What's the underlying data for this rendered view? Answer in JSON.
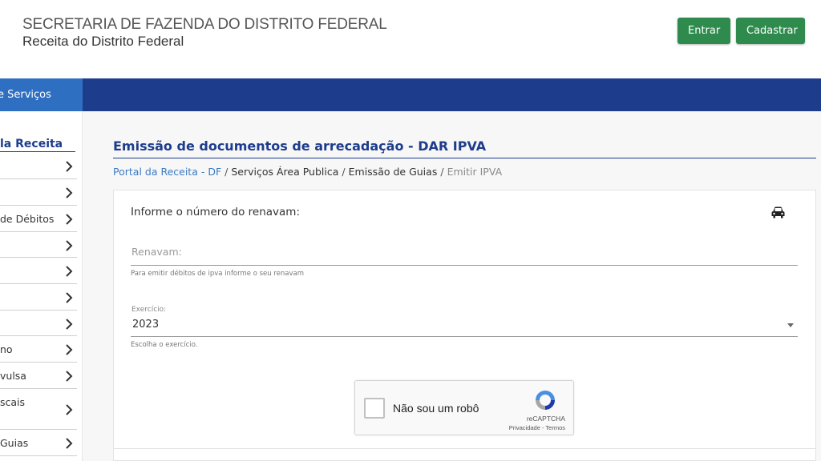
{
  "header": {
    "org": "SECRETARIA DE FAZENDA DO DISTRITO FEDERAL",
    "subtitle": "Receita do Distrito Federal",
    "login_label": "Entrar",
    "register_label": "Cadastrar",
    "button_color": "#2e8b4d"
  },
  "nav": {
    "active_tab": "e Serviços",
    "bar_color": "#1d3c8c",
    "active_color": "#2f6fc2"
  },
  "sidebar": {
    "title": "la Receita",
    "items": [
      {
        "label": "",
        "icon": "chevron-right-icon"
      },
      {
        "label": "",
        "icon": "chevron-right-icon"
      },
      {
        "label": "de Débitos",
        "icon": "chevron-right-icon"
      },
      {
        "label": "",
        "icon": "chevron-right-icon"
      },
      {
        "label": "",
        "icon": "chevron-right-icon"
      },
      {
        "label": "",
        "icon": "chevron-right-icon"
      },
      {
        "label": "",
        "icon": "chevron-right-icon"
      },
      {
        "label": "no",
        "icon": "chevron-right-icon"
      },
      {
        "label": "vulsa",
        "icon": "chevron-right-icon"
      },
      {
        "label": "scais",
        "icon": "chevron-right-icon"
      },
      {
        "label": "Guias",
        "icon": "chevron-right-icon"
      }
    ]
  },
  "main": {
    "title": "Emissão de documentos de arrecadação - DAR IPVA",
    "breadcrumb": [
      "Portal da Receita - DF",
      "Serviços Área Publica",
      "Emissão de Guias",
      "Emitir IPVA"
    ],
    "breadcrumb_separator": "/",
    "form": {
      "lead": "Informe o número do renavam:",
      "lead_icon": "car-icon",
      "renavam_placeholder": "Renavam:",
      "renavam_hint": "Para emitir débitos de ipva informe o seu renavam",
      "exercicio_label": "Exercício:",
      "exercicio_value": "2023",
      "exercicio_hint": "Escolha o exercício."
    },
    "captcha": {
      "label": "Não sou um robô",
      "brand": "reCAPTCHA",
      "terms": "Privacidade - Termos"
    }
  }
}
